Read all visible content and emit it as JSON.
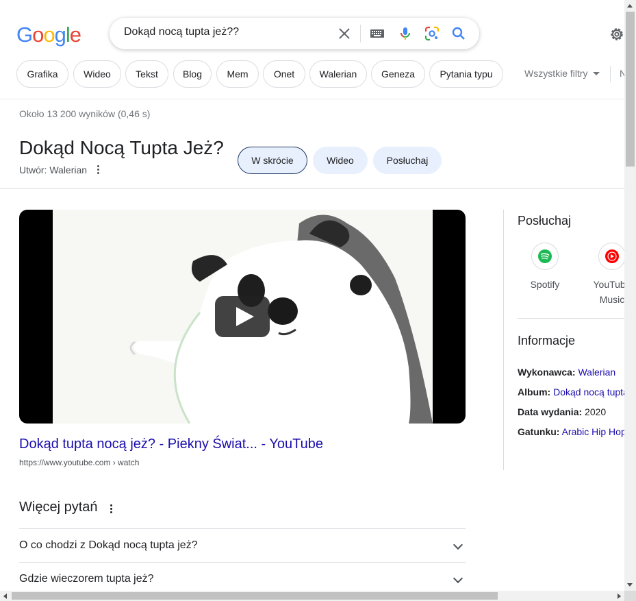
{
  "search": {
    "query": "Dokąd nocą tupta jeż??"
  },
  "logo": {
    "letters": [
      "G",
      "o",
      "o",
      "g",
      "l",
      "e"
    ],
    "colors": [
      "#4285F4",
      "#EA4335",
      "#FBBC05",
      "#4285F4",
      "#34A853",
      "#EA4335"
    ]
  },
  "chips": [
    "Grafika",
    "Wideo",
    "Tekst",
    "Blog",
    "Mem",
    "Onet",
    "Walerian",
    "Geneza",
    "Pytania typu"
  ],
  "tools": {
    "all_filters": "Wszystkie filtry",
    "next": "N"
  },
  "result_stats": "Około 13 200 wyników (0,46 s)",
  "knowledge": {
    "title": "Dokąd Nocą Tupta Jeż?",
    "subtitle": "Utwór: Walerian",
    "tabs": [
      "W skrócie",
      "Wideo",
      "Posłuchaj"
    ]
  },
  "video": {
    "title": "Dokąd tupta nocą jeż? - Piekny Świat... - YouTube",
    "url": "https://www.youtube.com › watch"
  },
  "questions": {
    "heading": "Więcej pytań",
    "items": [
      "O co chodzi z Dokąd nocą tupta jeż?",
      "Gdzie wieczorem tupta jeż?"
    ]
  },
  "right_panel": {
    "listen_heading": "Posłuchaj",
    "services": [
      {
        "label": "Spotify",
        "icon": "spotify-icon"
      },
      {
        "label": "YouTube Music",
        "icon": "youtube-music-icon"
      }
    ],
    "info_heading": "Informacje",
    "info": [
      {
        "key": "Wykonawca:",
        "value": "Walerian",
        "link": true
      },
      {
        "key": "Album:",
        "value": "Dokąd nocą tupta jeż?",
        "link": true
      },
      {
        "key": "Data wydania:",
        "value": "2020",
        "link": false
      },
      {
        "key": "Gatunku:",
        "value": "Arabic Hip Hop",
        "link": true
      }
    ]
  },
  "colors": {
    "link": "#1a0dab",
    "chip_border": "#dadce0",
    "tab_bg": "#e8f0fe"
  }
}
